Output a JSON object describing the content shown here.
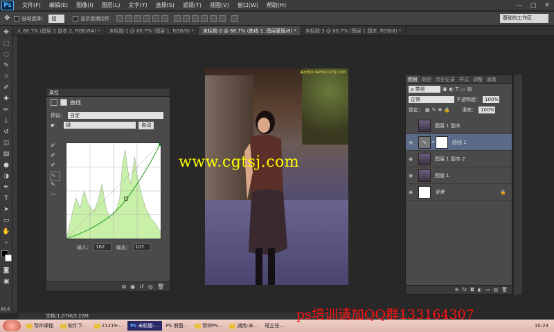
{
  "app": {
    "logo": "Ps"
  },
  "menu": [
    "文件(F)",
    "编辑(E)",
    "图像(I)",
    "图层(L)",
    "文字(Y)",
    "选择(S)",
    "滤镜(T)",
    "视图(V)",
    "窗口(W)",
    "帮助(H)"
  ],
  "window_controls": {
    "minimize": "—",
    "maximize": "□",
    "close": "✕"
  },
  "options": {
    "auto_select_label": "自动选择：",
    "auto_select_value": "组",
    "show_transform_label": "显示变换控件",
    "workspace": "基础的工作区"
  },
  "tabs": [
    {
      "label": "人 66.7% (图层 2 副本 2, RGB/8#) *",
      "active": false
    },
    {
      "label": "未标题-1 @ 66.7% (图层 1, RGB/8) *",
      "active": false
    },
    {
      "label": "未标题-2 @ 66.7% (曲线 1, 图层蒙版/8) *",
      "active": true
    },
    {
      "label": "未标题-3 @ 66.7% (图层 1 副本, RGB/8) *",
      "active": false
    }
  ],
  "watermark": "www.cgtsj.com",
  "photo_top_text": "美女照片·WWW.CGTSJ.COM",
  "properties": {
    "title": "属性",
    "subtitle": "曲线",
    "preset_label": "预设：",
    "preset_value": "自定",
    "channel_value": "绿",
    "auto_button": "自动",
    "input_label": "输入：",
    "input_value": "162",
    "output_label": "输出：",
    "output_value": "107"
  },
  "layers": {
    "tabs": [
      "图层",
      "路径",
      "历史记录",
      "样式",
      "调整",
      "画笔"
    ],
    "filter_value": "ρ 类型",
    "blend_mode": "正常",
    "opacity_label": "不透明度：",
    "opacity_value": "100%",
    "lock_label": "锁定：",
    "fill_label": "填充：",
    "fill_value": "100%",
    "items": [
      {
        "name": "图层 1 副本",
        "visible": false,
        "selected": false
      },
      {
        "name": "曲线 1",
        "visible": true,
        "selected": true
      },
      {
        "name": "图层 1 副本 2",
        "visible": true,
        "selected": false
      },
      {
        "name": "图层 1",
        "visible": true,
        "selected": false
      },
      {
        "name": "背景",
        "visible": true,
        "selected": false
      }
    ],
    "foot_icons": [
      "⊕",
      "fx",
      "◘",
      "◐",
      "▭",
      "▤",
      "🗑"
    ]
  },
  "status": {
    "zoom": "66.6",
    "doc": "文档:1.07M/3.22M"
  },
  "promo": "ps培训请加QQ群133164307",
  "taskbar": {
    "items": [
      {
        "label": "帮帅课程",
        "active": false
      },
      {
        "label": "软件下...",
        "active": false
      },
      {
        "label": "21219-...",
        "active": false
      },
      {
        "label": "未标题-...",
        "active": true
      },
      {
        "label": "PS 俏图...",
        "active": false
      },
      {
        "label": "帮帅PS...",
        "active": false
      },
      {
        "label": "湖南·米...",
        "active": false
      },
      {
        "label": "班主任...",
        "active": false
      }
    ],
    "clock": "10:24"
  },
  "colors": {
    "accent": "#4db3ff",
    "selected_layer": "#5a6a88",
    "watermark": "#ffff00",
    "promo": "#ff1010"
  }
}
